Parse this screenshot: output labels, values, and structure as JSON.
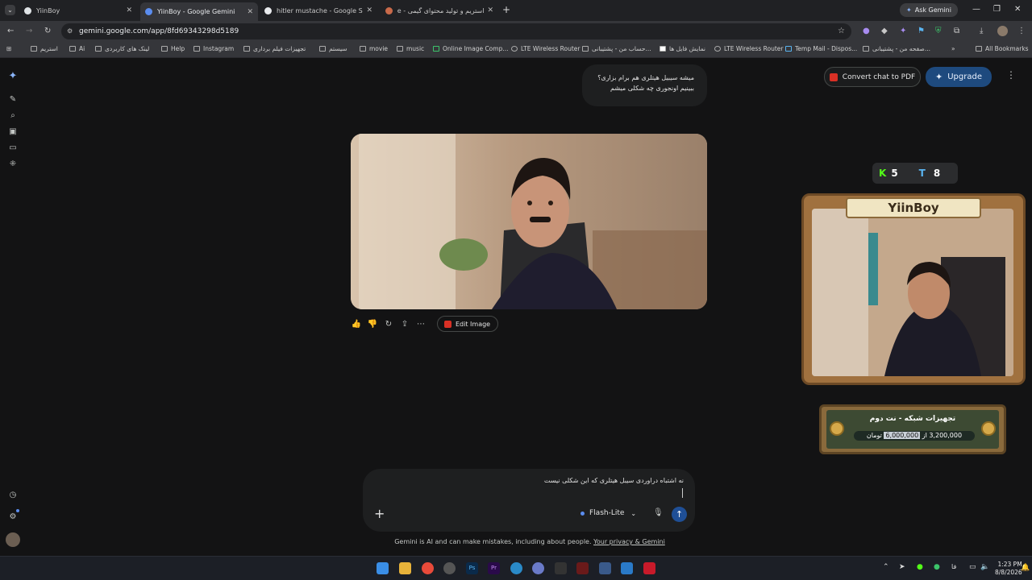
{
  "tabs": [
    {
      "title": "YiinBoy",
      "active": false
    },
    {
      "title": "YiinBoy - Google Gemini",
      "active": true
    },
    {
      "title": "hitler mustache - Google Search",
      "active": false
    },
    {
      "title": "استریم و تولید محتوای گیمی - le",
      "active": false
    }
  ],
  "ask_gemini": "Ask Gemini",
  "url": "gemini.google.com/app/8fd69343298d5189",
  "bookmarks": [
    "استریم",
    "Ai",
    "لینک های کاربردی",
    "Help",
    "Instagram",
    "تجهیزات فیلم برداری",
    "سیستم",
    "movie",
    "music",
    "Online Image Comp...",
    "LTE Wireless Router",
    "حساب من - پشتیبانی...",
    "نمایش فایل ها",
    "LTE Wireless Router",
    "Temp Mail - Dispos...",
    "صفحه من - پشتیبانی..."
  ],
  "all_bookmarks": "All Bookmarks",
  "chat": {
    "user_message_line1": "میشه سیبیل هیتلری هم برام بزاری؟",
    "user_message_line2": "ببینیم اونجوری چه شکلی میشم",
    "edit_image_label": "Edit Image"
  },
  "header": {
    "convert_pdf": "Convert chat to PDF",
    "upgrade": "Upgrade"
  },
  "overlay": {
    "kick_count": "5",
    "other_count": "8",
    "cam_title": "YiinBoy",
    "goal_title": "تجهیزات شبکه - نت دوم",
    "goal_current": "3,200,000",
    "goal_of": "از",
    "goal_target": "6,000,000",
    "goal_currency": "تومان"
  },
  "prompt": {
    "text": "نه اشتباه دراوردی سیبل هیتلری که این شکلی نیست",
    "model": "Flash-Lite"
  },
  "disclaimer": {
    "text": "Gemini is AI and can make mistakes, including about people.",
    "link": "Your privacy & Gemini"
  },
  "clock": {
    "time": "1:23 PM",
    "date": "8/8/2026"
  },
  "tray_lang": "فا",
  "colors": {
    "accent": "#1f4f96",
    "background": "#131314",
    "surface": "#1e1f20"
  }
}
